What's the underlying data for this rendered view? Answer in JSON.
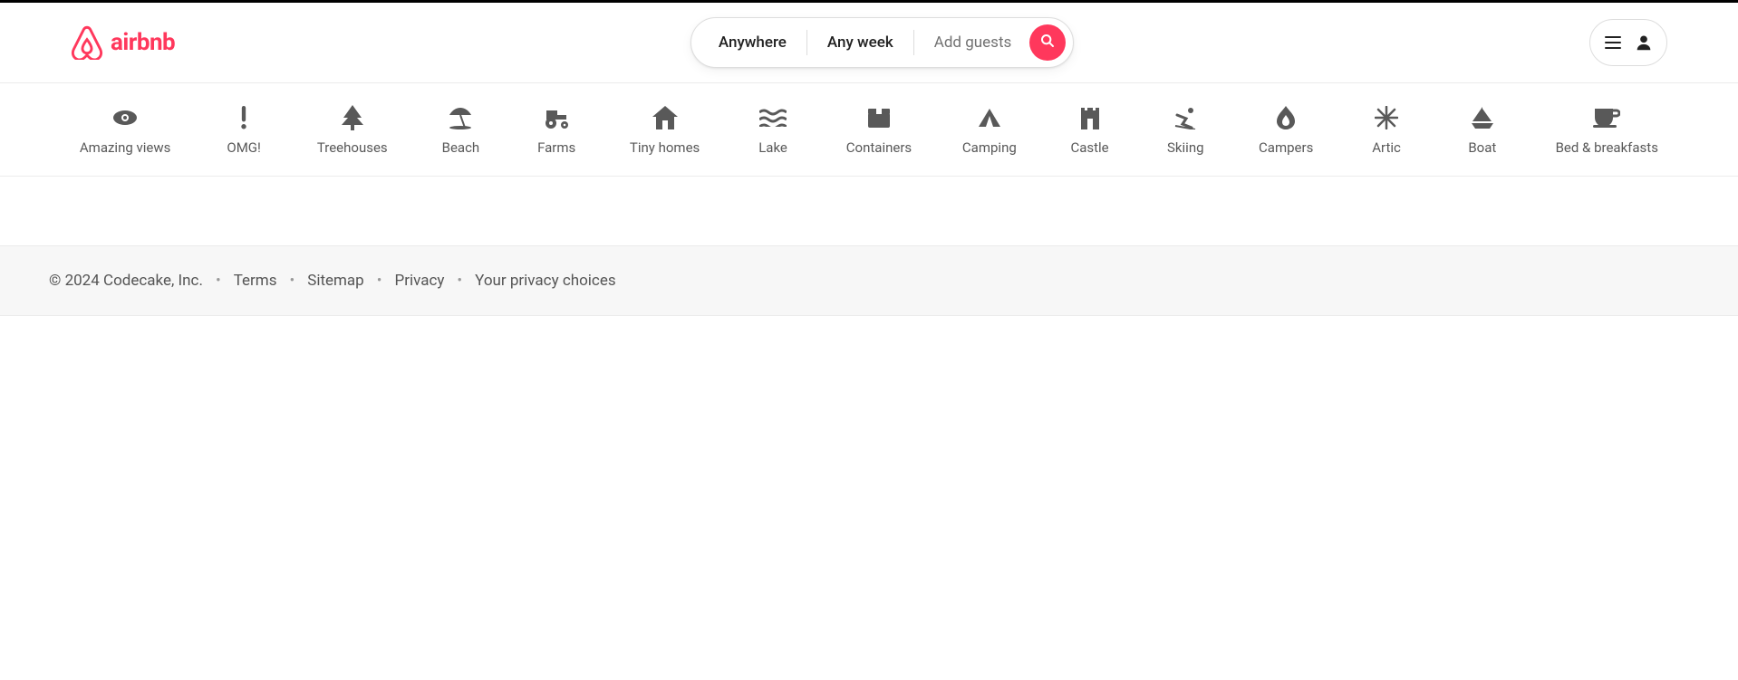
{
  "brand": {
    "name": "airbnb",
    "accent": "#ff385c"
  },
  "search": {
    "where": "Anywhere",
    "when": "Any week",
    "who": "Add guests"
  },
  "categories": [
    {
      "label": "Amazing views",
      "icon": "eye-icon"
    },
    {
      "label": "OMG!",
      "icon": "exclamation-icon"
    },
    {
      "label": "Treehouses",
      "icon": "tree-icon"
    },
    {
      "label": "Beach",
      "icon": "umbrella-icon"
    },
    {
      "label": "Farms",
      "icon": "tractor-icon"
    },
    {
      "label": "Tiny homes",
      "icon": "house-icon"
    },
    {
      "label": "Lake",
      "icon": "water-icon"
    },
    {
      "label": "Containers",
      "icon": "box-icon"
    },
    {
      "label": "Camping",
      "icon": "tent-icon"
    },
    {
      "label": "Castle",
      "icon": "castle-icon"
    },
    {
      "label": "Skiing",
      "icon": "skiing-icon"
    },
    {
      "label": "Campers",
      "icon": "fire-icon"
    },
    {
      "label": "Artic",
      "icon": "snowflake-icon"
    },
    {
      "label": "Boat",
      "icon": "sailboat-icon"
    },
    {
      "label": "Bed & breakfasts",
      "icon": "cup-icon"
    }
  ],
  "footer": {
    "copyright": "© 2024 Codecake, Inc.",
    "links": [
      "Terms",
      "Sitemap",
      "Privacy",
      "Your privacy choices"
    ]
  }
}
